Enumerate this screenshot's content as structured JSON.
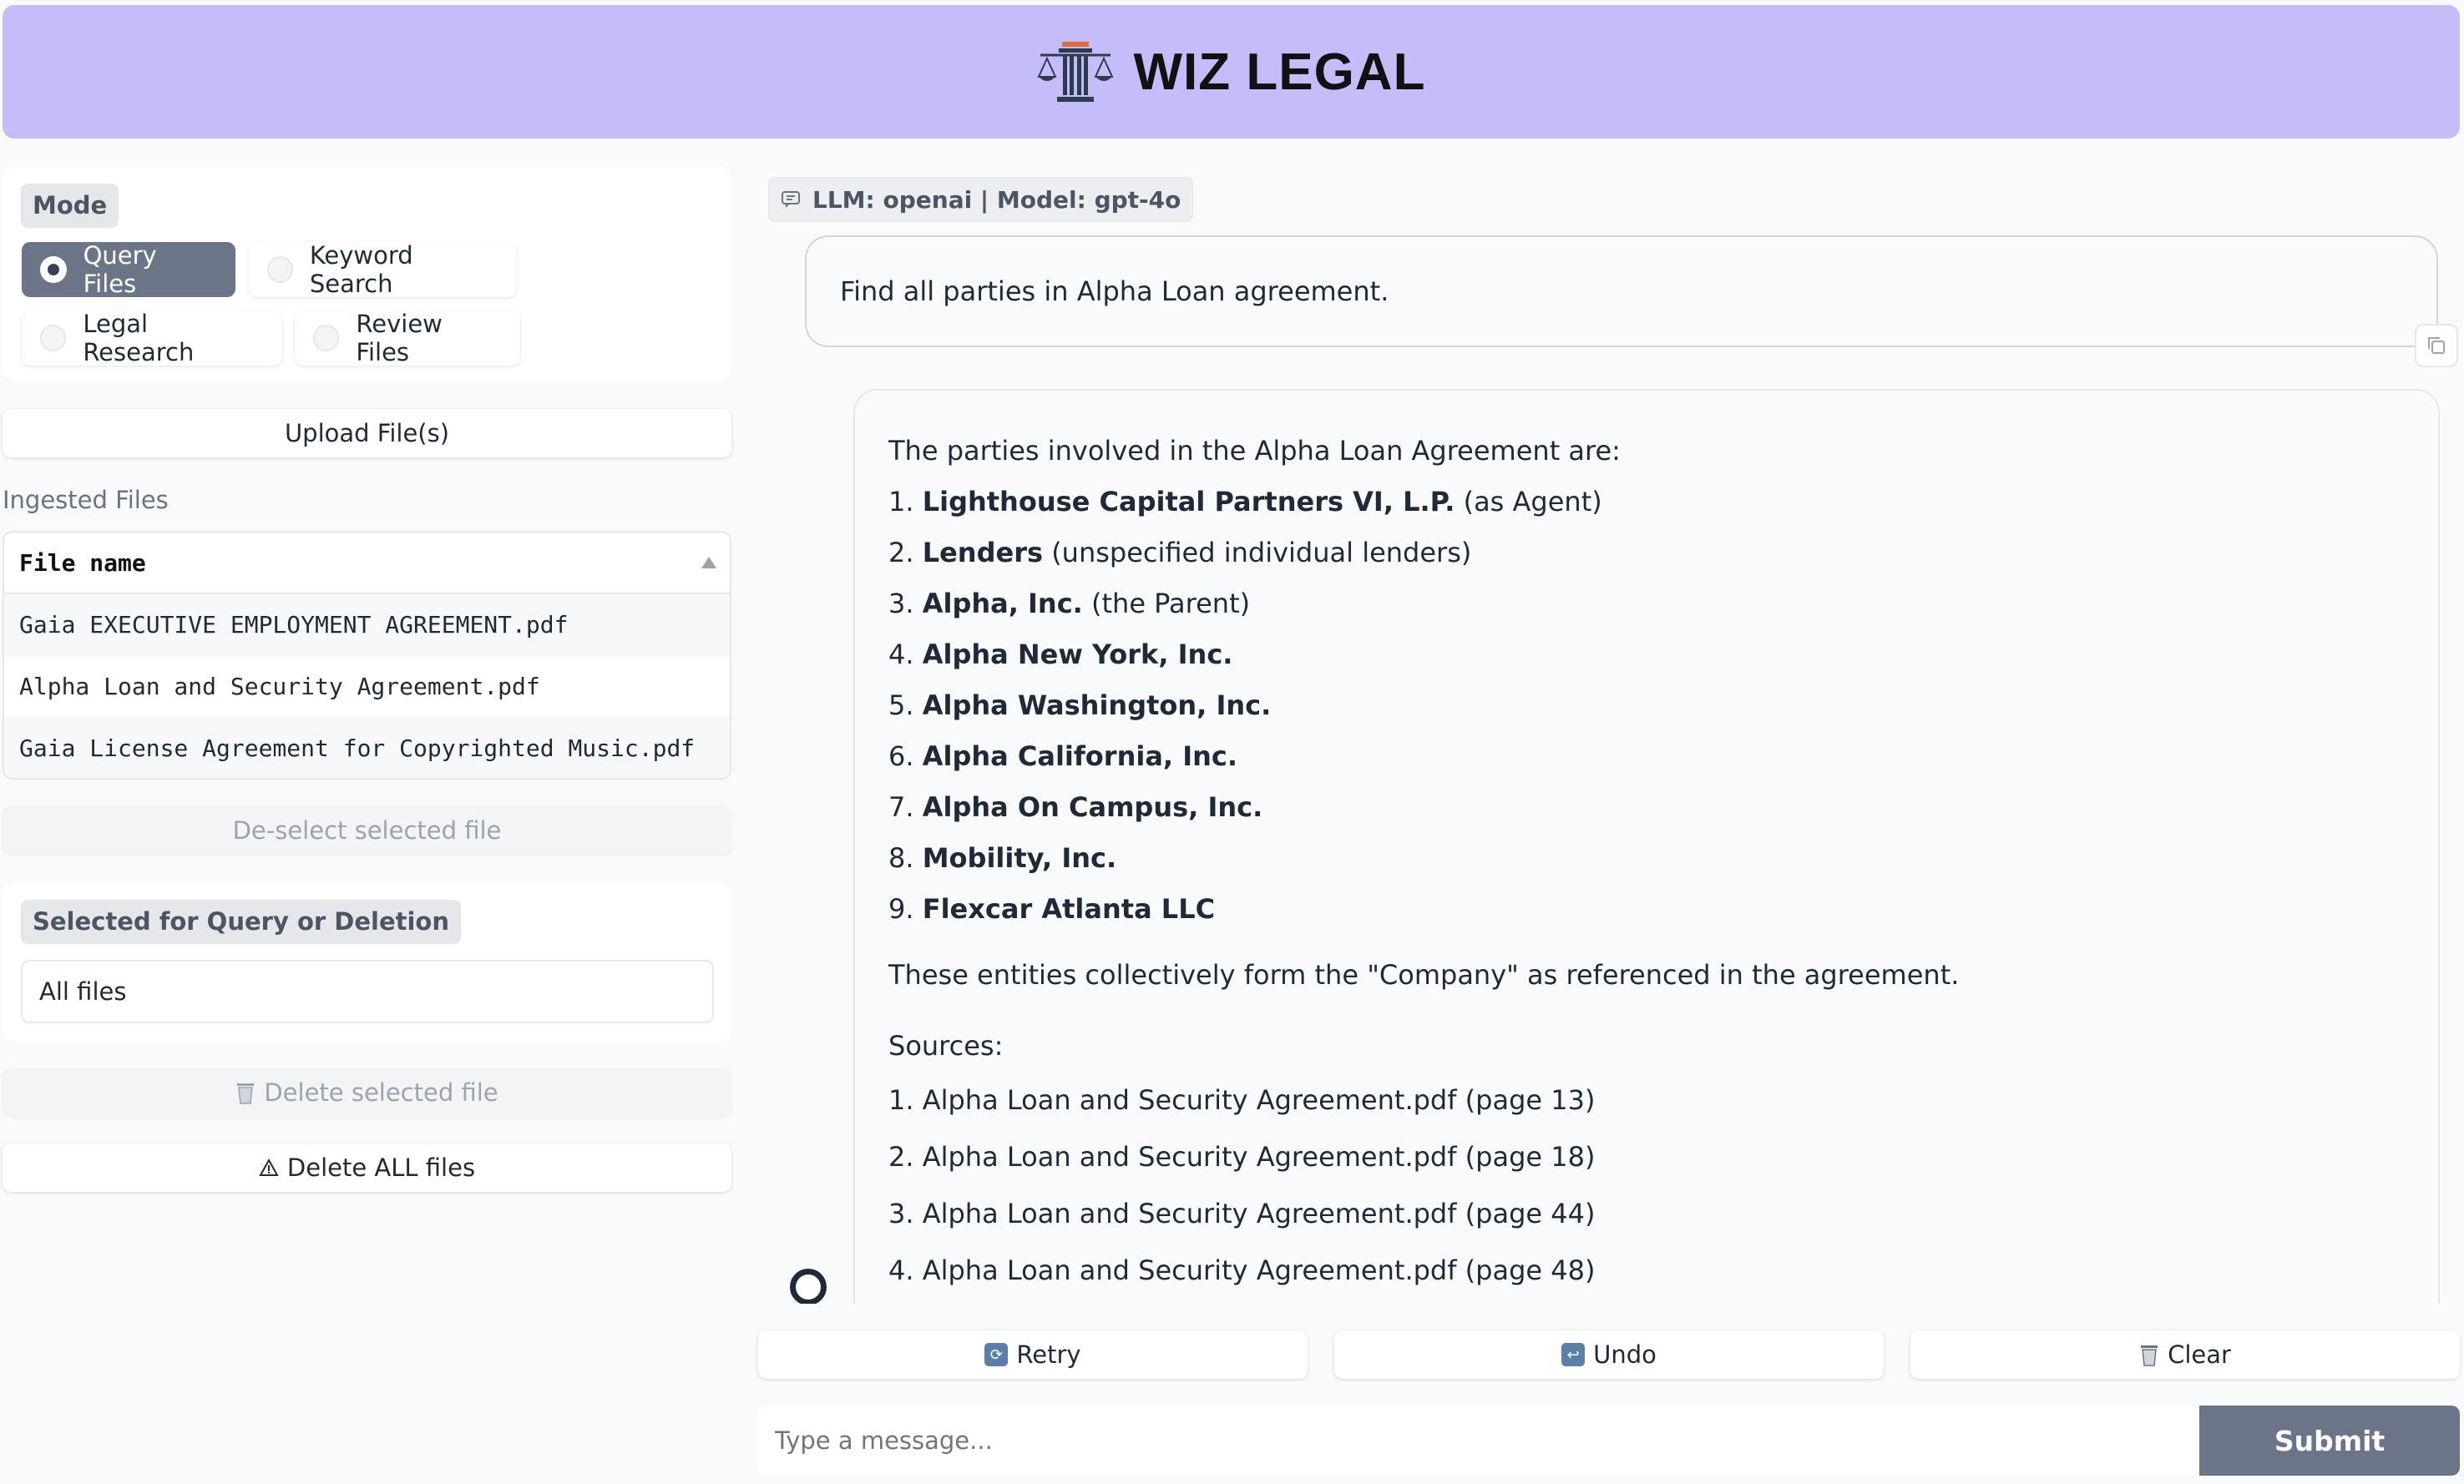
{
  "header": {
    "title": "WIZ LEGAL",
    "logo_icon": "courthouse-scales-icon"
  },
  "mode": {
    "label": "Mode",
    "options": [
      "Query Files",
      "Keyword Search",
      "Legal Research",
      "Review Files"
    ],
    "selected": "Query Files"
  },
  "upload": {
    "label": "Upload File(s)"
  },
  "ingested": {
    "label": "Ingested Files",
    "column": "File name",
    "files": [
      "Gaia EXECUTIVE EMPLOYMENT AGREEMENT.pdf",
      "Alpha Loan and Security Agreement.pdf",
      "Gaia License Agreement for Copyrighted Music.pdf"
    ]
  },
  "deselect": {
    "label": "De-select selected file"
  },
  "selected": {
    "label": "Selected for Query or Deletion",
    "value": "All files"
  },
  "delete_selected": {
    "label": "Delete selected file"
  },
  "delete_all": {
    "label": "Delete ALL files"
  },
  "chat": {
    "llm_info": "LLM: openai | Model: gpt-4o",
    "user_message": "Find all parties in Alpha Loan agreement.",
    "answer_intro": "The parties involved in the Alpha Loan Agreement are:",
    "parties": [
      {
        "num": "1.",
        "name": "Lighthouse Capital Partners VI, L.P.",
        "note": "(as Agent)"
      },
      {
        "num": "2.",
        "name": "Lenders",
        "note": "(unspecified individual lenders)"
      },
      {
        "num": "3.",
        "name": "Alpha, Inc.",
        "note": "(the Parent)"
      },
      {
        "num": "4.",
        "name": "Alpha New York, Inc.",
        "note": ""
      },
      {
        "num": "5.",
        "name": "Alpha Washington, Inc.",
        "note": ""
      },
      {
        "num": "6.",
        "name": "Alpha California, Inc.",
        "note": ""
      },
      {
        "num": "7.",
        "name": "Alpha On Campus, Inc.",
        "note": ""
      },
      {
        "num": "8.",
        "name": "Mobility, Inc.",
        "note": ""
      },
      {
        "num": "9.",
        "name": "Flexcar Atlanta LLC",
        "note": ""
      }
    ],
    "answer_outro": "These entities collectively form the \"Company\" as referenced in the agreement.",
    "sources_title": "Sources:",
    "sources": [
      "1. Alpha Loan and Security Agreement.pdf (page 13)",
      "2. Alpha Loan and Security Agreement.pdf (page 18)",
      "3. Alpha Loan and Security Agreement.pdf (page 44)",
      "4. Alpha Loan and Security Agreement.pdf (page 48)"
    ]
  },
  "actions": {
    "retry": "Retry",
    "undo": "Undo",
    "clear": "Clear"
  },
  "input": {
    "placeholder": "Type a message...",
    "submit": "Submit"
  },
  "colors": {
    "header_bg": "#c4bdfa",
    "primary_button": "#6b7587"
  }
}
